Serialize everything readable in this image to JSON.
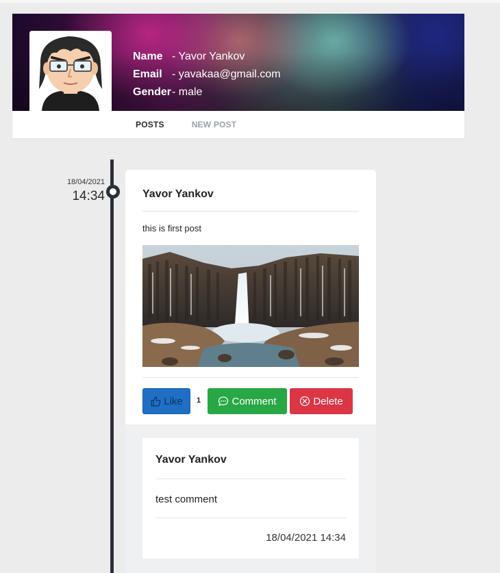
{
  "profile": {
    "name_label": "Name",
    "name_value": "- Yavor Yankov",
    "email_label": "Email",
    "email_value": "- yavakaa@gmail.com",
    "gender_label": "Gender",
    "gender_value": "- male",
    "avatar_icon": "cartoon-avatar"
  },
  "tabs": [
    {
      "label": "POSTS",
      "active": true
    },
    {
      "label": "NEW POST",
      "active": false
    }
  ],
  "timeline": {
    "date": "18/04/2021",
    "time": "14:34"
  },
  "post": {
    "author": "Yavor Yankov",
    "text": "this is first post",
    "image_alt": "waterfall-photo",
    "like_label": "Like",
    "like_count": "1",
    "comment_label": "Comment",
    "delete_label": "Delete",
    "colors": {
      "like": "#1f6fc5",
      "comment": "#28a745",
      "delete": "#dc3545"
    }
  },
  "comment": {
    "author": "Yavor Yankov",
    "text": "test comment",
    "date": "18/04/2021 14:34"
  }
}
